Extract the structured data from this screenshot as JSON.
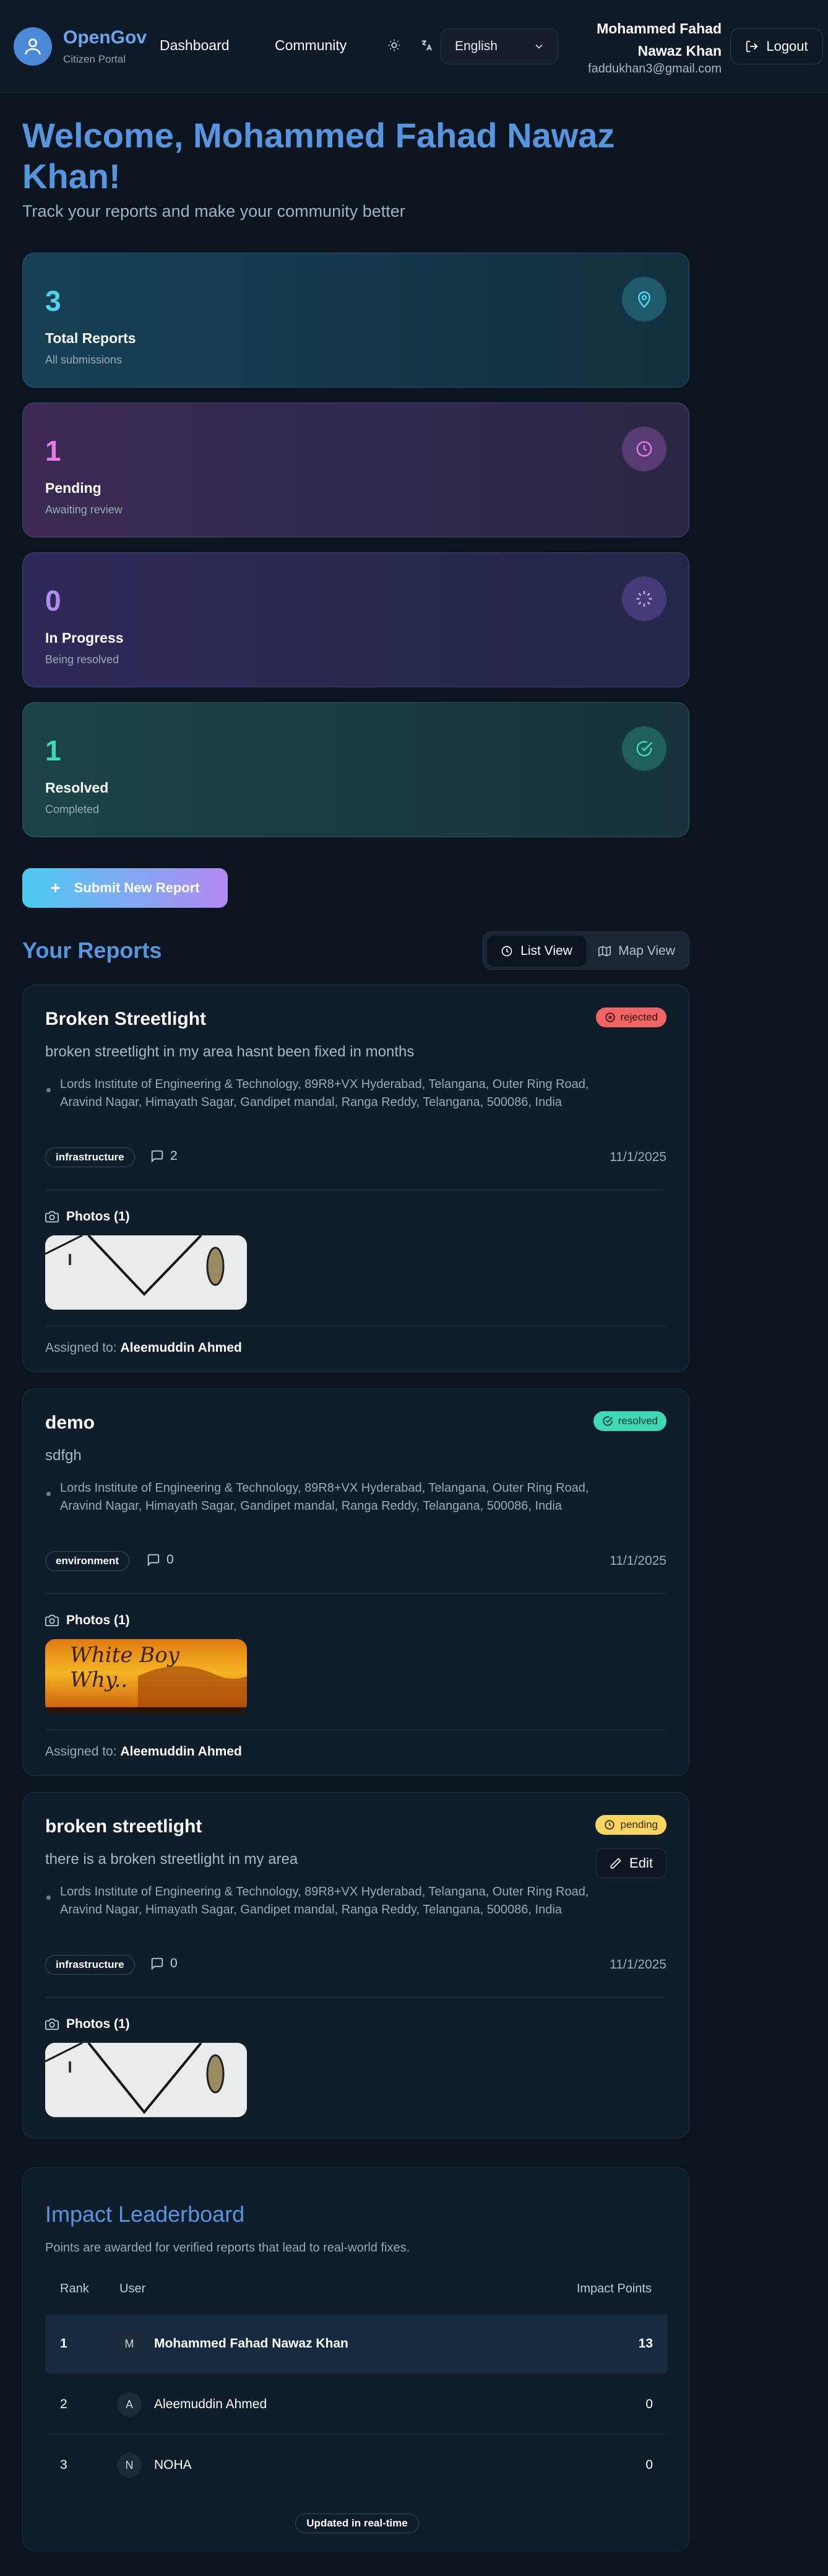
{
  "header": {
    "brand": "OpenGov",
    "brand_sub": "Citizen Portal",
    "nav": [
      "Dashboard",
      "Community"
    ],
    "language": "English",
    "user_name": "Mohammed Fahad Nawaz Khan",
    "user_email": "faddukhan3@gmail.com",
    "logout_label": "Logout"
  },
  "welcome": {
    "title": "Welcome, Mohammed Fahad Nawaz Khan!",
    "subtitle": "Track your reports and make your community better"
  },
  "stats": [
    {
      "value": "3",
      "label": "Total Reports",
      "sub": "All submissions",
      "icon": "map-pin-icon",
      "color": "#4fd3f0"
    },
    {
      "value": "1",
      "label": "Pending",
      "sub": "Awaiting review",
      "icon": "clock-icon",
      "color": "#e57ce6"
    },
    {
      "value": "0",
      "label": "In Progress",
      "sub": "Being resolved",
      "icon": "loader-icon",
      "color": "#b38af2"
    },
    {
      "value": "1",
      "label": "Resolved",
      "sub": "Completed",
      "icon": "check-circle-icon",
      "color": "#3fd8b4"
    }
  ],
  "submit_label": "Submit New Report",
  "reports_title": "Your Reports",
  "view_toggle": {
    "list": "List View",
    "map": "Map View",
    "active": "list"
  },
  "reports": [
    {
      "title": "Broken Streetlight",
      "description": "broken streetlight in my area hasnt been fixed in months",
      "location": "Lords Institute of Engineering & Technology, 89R8+VX Hyderabad, Telangana, Outer Ring Road, Aravind Nagar, Himayath Sagar, Gandipet mandal, Ranga Reddy, Telangana, 500086, India",
      "status": "rejected",
      "category": "infrastructure",
      "comments": "2",
      "date": "11/1/2025",
      "photos_label": "Photos (1)",
      "assigned_prefix": "Assigned to:",
      "assigned_to": "Aleemuddin Ahmed"
    },
    {
      "title": "demo",
      "description": "sdfgh",
      "location": "Lords Institute of Engineering & Technology, 89R8+VX Hyderabad, Telangana, Outer Ring Road, Aravind Nagar, Himayath Sagar, Gandipet mandal, Ranga Reddy, Telangana, 500086, India",
      "status": "resolved",
      "category": "environment",
      "comments": "0",
      "date": "11/1/2025",
      "photos_label": "Photos (1)",
      "photo_text": "White Boy Why..",
      "assigned_prefix": "Assigned to:",
      "assigned_to": "Aleemuddin Ahmed"
    },
    {
      "title": "broken streetlight",
      "description": "there is a broken streetlight in my area",
      "location": "Lords Institute of Engineering & Technology, 89R8+VX Hyderabad, Telangana, Outer Ring Road, Aravind Nagar, Himayath Sagar, Gandipet mandal, Ranga Reddy, Telangana, 500086, India",
      "status": "pending",
      "edit_label": "Edit",
      "category": "infrastructure",
      "comments": "0",
      "date": "11/1/2025",
      "photos_label": "Photos (1)"
    }
  ],
  "leaderboard": {
    "title": "Impact Leaderboard",
    "subtitle": "Points are awarded for verified reports that lead to real-world fixes.",
    "headers": {
      "rank": "Rank",
      "user": "User",
      "points": "Impact Points"
    },
    "rows": [
      {
        "rank": "1",
        "initial": "M",
        "name": "Mohammed Fahad Nawaz Khan",
        "points": "13"
      },
      {
        "rank": "2",
        "initial": "A",
        "name": "Aleemuddin Ahmed",
        "points": "0"
      },
      {
        "rank": "3",
        "initial": "N",
        "name": "NOHA",
        "points": "0"
      }
    ],
    "badge": "Updated in real-time"
  },
  "colors": {
    "accent": "#5796df",
    "rejected": "#f06464",
    "resolved": "#3fd8b4",
    "pending": "#f7d560"
  }
}
